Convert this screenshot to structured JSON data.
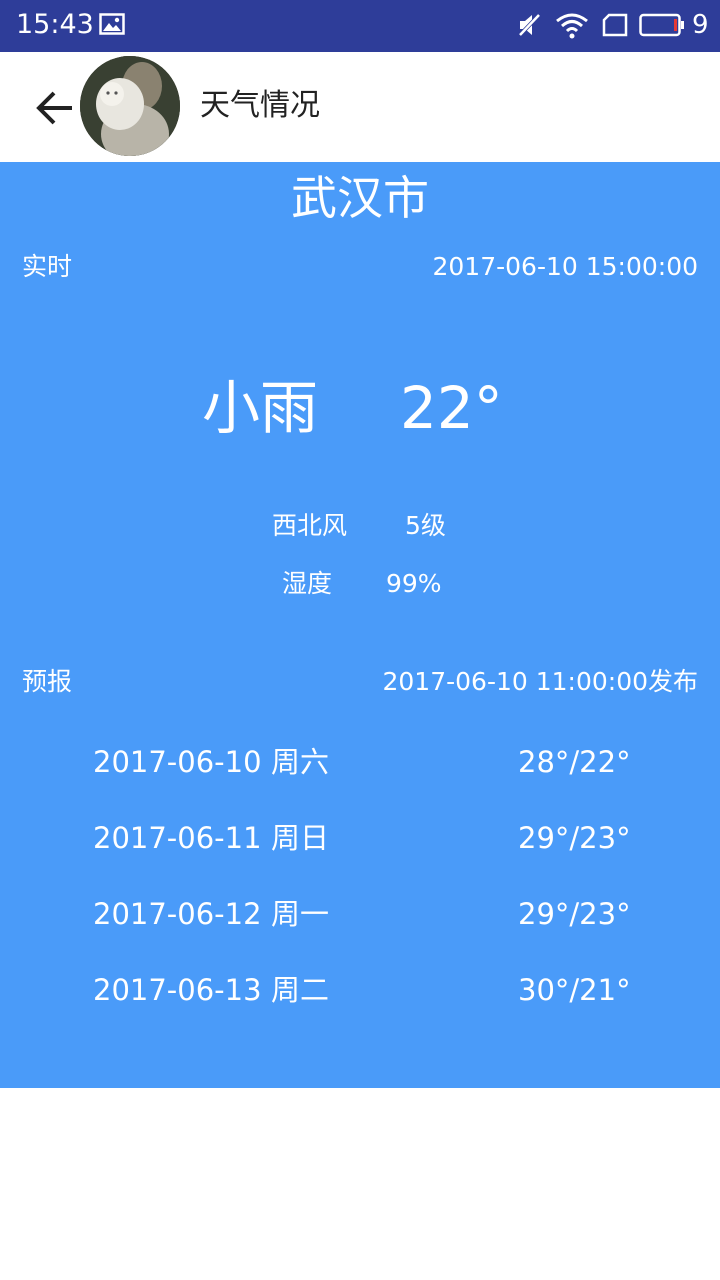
{
  "status_bar": {
    "time": "15:43",
    "battery_level": "9",
    "icons": [
      "image-icon",
      "mute-icon",
      "wifi-icon",
      "sim-icon",
      "battery-icon"
    ]
  },
  "app_bar": {
    "title": "天气情况",
    "back_icon": "back-arrow-icon"
  },
  "weather": {
    "city": "武汉市",
    "realtime_label": "实时",
    "realtime_time": "2017-06-10 15:00:00",
    "condition": "小雨",
    "temperature": "22°",
    "wind_direction": "西北风",
    "wind_level": "5级",
    "humidity_label": "湿度",
    "humidity_value": "99%",
    "forecast_label": "预报",
    "forecast_published": "2017-06-10 11:00:00发布",
    "forecast": [
      {
        "date": "2017-06-10",
        "day": "周六",
        "temp": "28°/22°"
      },
      {
        "date": "2017-06-11",
        "day": "周日",
        "temp": "29°/23°"
      },
      {
        "date": "2017-06-12",
        "day": "周一",
        "temp": "29°/23°"
      },
      {
        "date": "2017-06-13",
        "day": "周二",
        "temp": "30°/21°"
      }
    ]
  },
  "colors": {
    "status_bar": "#2e3d99",
    "panel": "#4a9bf9",
    "text_on_panel": "#ffffff",
    "app_bar": "#ffffff"
  }
}
